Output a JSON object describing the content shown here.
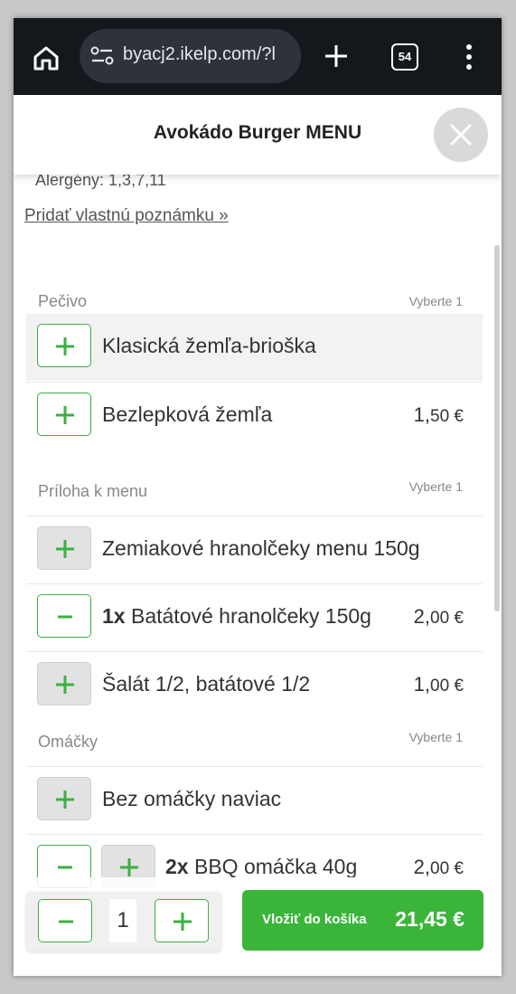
{
  "browser": {
    "url": "byacj2.ikelp.com/?l",
    "tab_count": "54",
    "icons": [
      "home-icon",
      "site-settings-icon",
      "new-tab-icon",
      "tab-switcher-icon",
      "more-menu-icon"
    ]
  },
  "header": {
    "title": "Avokádo Burger MENU"
  },
  "product": {
    "allergens": "Alergény: 1,3,7,11",
    "note_link": "Pridať vlastnú poznámku »"
  },
  "sections": [
    {
      "title": "Pečivo",
      "hint": "Vyberte 1",
      "rows": [
        {
          "label": "Klasická žemľa-brioška",
          "qty": "",
          "price_int": "",
          "price_dec": "",
          "price_cur": ""
        },
        {
          "label": "Bezlepková žemľa",
          "qty": "",
          "price_int": "1,",
          "price_dec": "50",
          "price_cur": " €"
        }
      ]
    },
    {
      "title": "Príloha k menu",
      "hint": "Vyberte 1",
      "rows": [
        {
          "label": "Zemiakové hranolčeky menu 150g",
          "qty": "",
          "price_int": "",
          "price_dec": "",
          "price_cur": ""
        },
        {
          "label": " Batátové hranolčeky 150g",
          "qty": "1x",
          "price_int": "2,",
          "price_dec": "00",
          "price_cur": " €"
        },
        {
          "label": "Šalát 1/2, batátové 1/2",
          "qty": "",
          "price_int": "1,",
          "price_dec": "00",
          "price_cur": " €"
        }
      ]
    },
    {
      "title": "Omáčky",
      "hint": "Vyberte 1",
      "rows": [
        {
          "label": "Bez omáčky naviac",
          "qty": "",
          "price_int": "",
          "price_dec": "",
          "price_cur": ""
        },
        {
          "label": " BBQ omáčka 40g",
          "qty": "2x",
          "price_int": "2,",
          "price_dec": "00",
          "price_cur": " €"
        }
      ]
    }
  ],
  "footer": {
    "quantity": "1",
    "add_to_cart_label": "Vložiť do košíka",
    "total": "21,45 €"
  },
  "colors": {
    "accent_green": "#3ab53a",
    "browser_bar": "#14171c"
  }
}
